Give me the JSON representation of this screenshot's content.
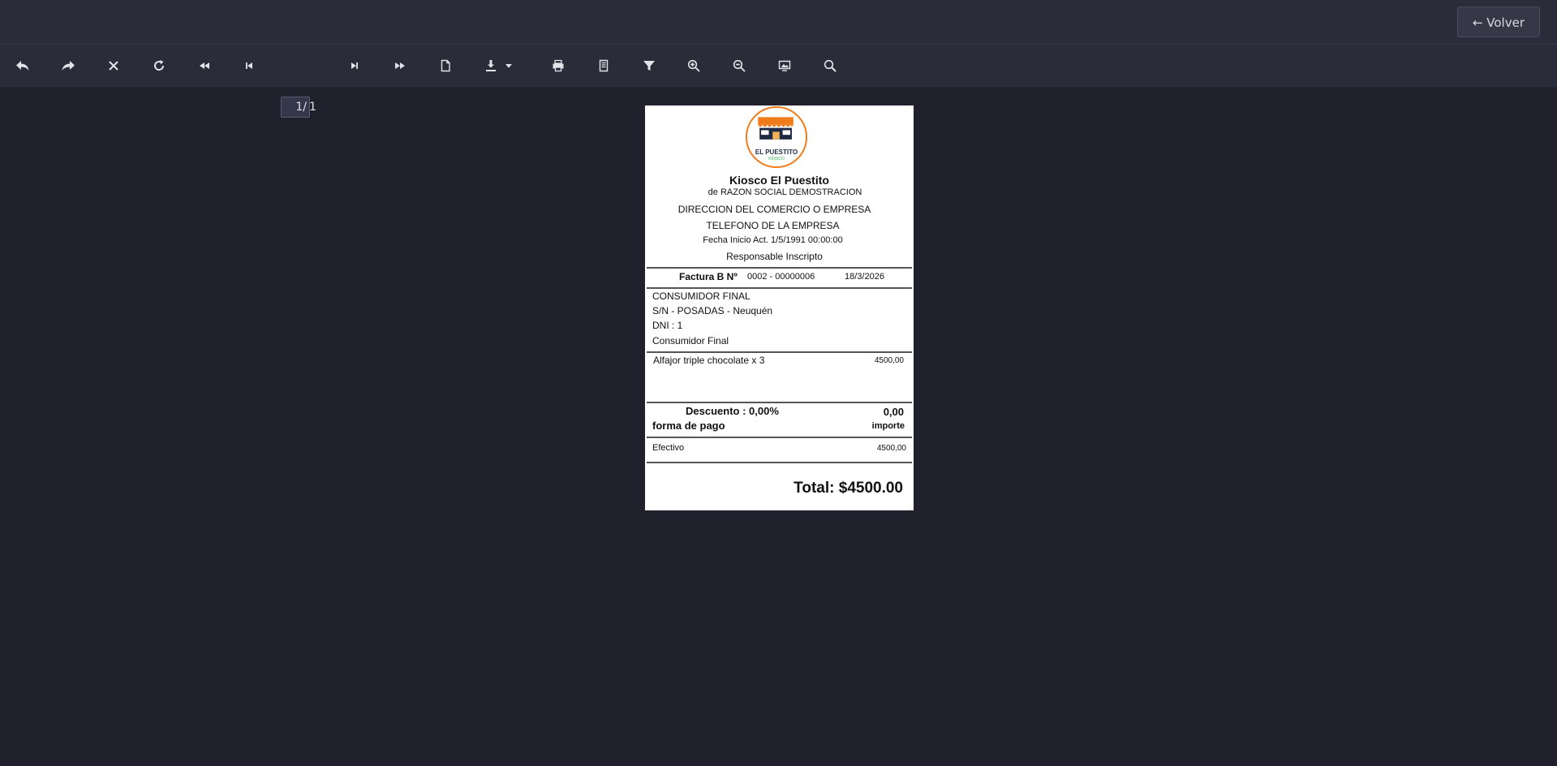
{
  "header": {
    "back_label": "← Volver"
  },
  "toolbar": {
    "page_current": "1/",
    "page_total": "1"
  },
  "icons": [
    "undo-icon",
    "redo-icon",
    "close-icon",
    "refresh-icon",
    "fast-backward-icon",
    "first-page-icon",
    "last-page-icon",
    "fast-forward-icon",
    "page-setup-icon",
    "download-icon",
    "chevron-down-icon",
    "print-icon",
    "export-icon",
    "filter-icon",
    "zoom-in-icon",
    "zoom-out-icon",
    "fit-page-icon",
    "search-icon"
  ],
  "receipt": {
    "logo": {
      "text": "EL PUESTITO",
      "subtext": "KIOSCO",
      "brand_color": "#f07b1a",
      "dark_color": "#1f2a44"
    },
    "business_name": "Kiosco El Puestito",
    "razon_social": "de RAZON SOCIAL DEMOSTRACION",
    "address": "DIRECCION DEL COMERCIO O EMPRESA",
    "phone": "TELEFONO DE LA EMPRESA",
    "start_date": "Fecha Inicio Act. 1/5/1991 00:00:00",
    "iva_condition": "Responsable Inscripto",
    "invoice_label": "Factura B Nº",
    "invoice_number": "0002 - 00000006",
    "invoice_date": "18/3/2026",
    "customer": {
      "name": "CONSUMIDOR FINAL",
      "address": "S/N - POSADAS - Neuquén",
      "dni": "DNI : 1",
      "condition": "Consumidor Final"
    },
    "items": [
      {
        "description": "Alfajor triple chocolate x 3",
        "amount": "4500,00"
      }
    ],
    "discount_label": "Descuento : 0,00%",
    "discount_amount": "0,00",
    "payment_label": "forma de pago",
    "amount_label": "importe",
    "payments": [
      {
        "method": "Efectivo",
        "amount": "4500,00"
      }
    ],
    "total": "Total: $4500.00"
  }
}
